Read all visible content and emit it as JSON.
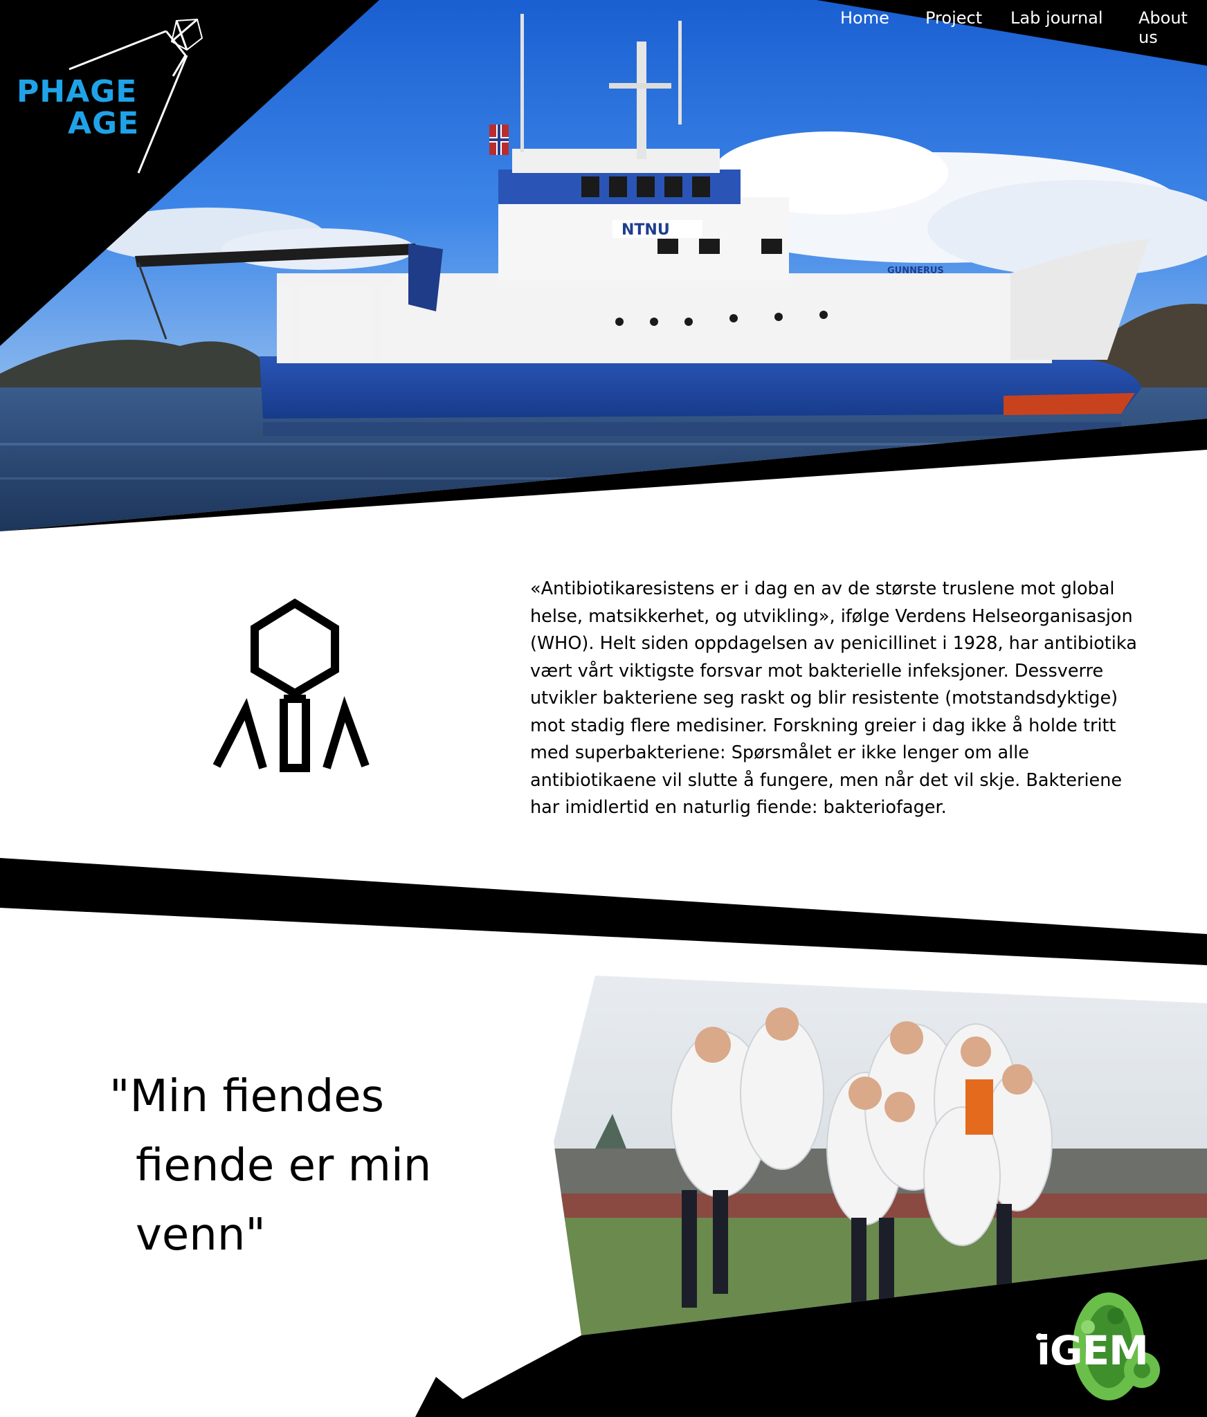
{
  "brand": {
    "logo_line1": "PHAGE",
    "logo_line2": "AGE",
    "logo_color": "#1fa3e8"
  },
  "nav": {
    "items": [
      {
        "label": "Home"
      },
      {
        "label": "Project"
      },
      {
        "label": "Lab journal"
      },
      {
        "label": "About us"
      }
    ]
  },
  "hero": {
    "image": "research-vessel-photo",
    "ship_brand": "NTNU",
    "ship_name": "GUNNERUS"
  },
  "intro": {
    "icon": "bacteriophage-icon",
    "text": "«Antibiotikaresistens er i dag en av de største truslene mot global helse, matsikkerhet, og utvikling», ifølge Verdens Helseorganisasjon (WHO). Helt siden oppdagelsen av penicillinet i 1928, har antibiotika vært vårt viktigste forsvar mot bakterielle infeksjoner. Dessverre utvikler bakteriene seg raskt og blir resistente (motstandsdyktige) mot stadig flere medisiner. Forskning greier i dag ikke å holde tritt med superbakteriene: Spørsmålet er ikke lenger om alle antibiotikaene vil slutte å fungere, men når det vil skje. Bakteriene har imidlertid en naturlig fiende: bakteriofager."
  },
  "quote": {
    "line1": "\"Min fiendes",
    "line2": "fiende er min venn\""
  },
  "team": {
    "image": "team-jumping-photo"
  },
  "footer": {
    "igem_label": "iGEM",
    "igem_color": "#6abf4b"
  },
  "colors": {
    "background": "#ffffff",
    "band": "#000000",
    "accent": "#1fa3e8"
  }
}
